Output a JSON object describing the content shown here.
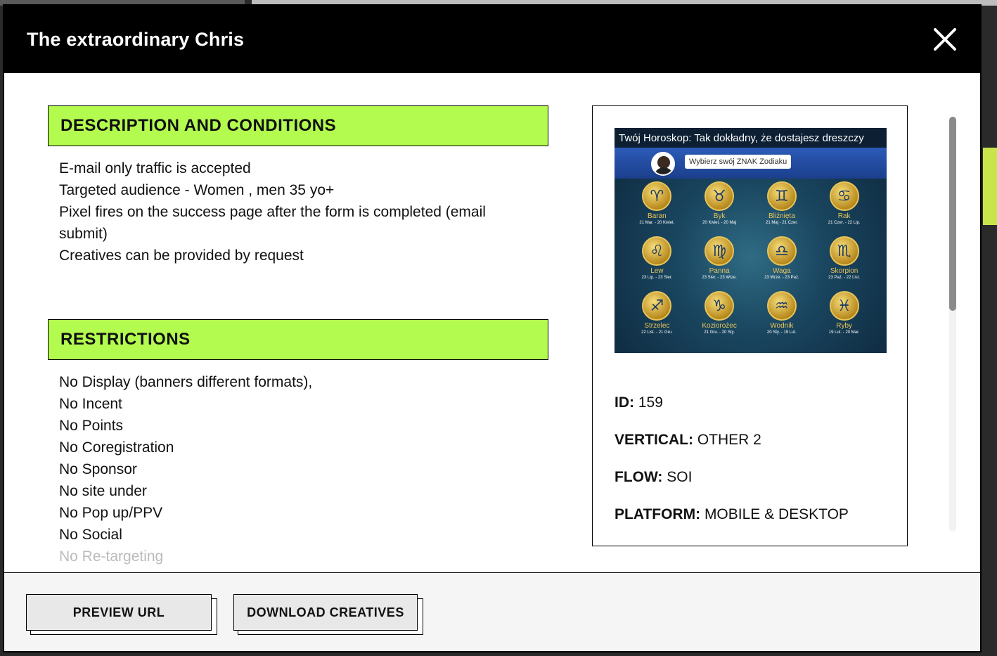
{
  "modal": {
    "title": "The extraordinary Chris"
  },
  "description": {
    "heading": "DESCRIPTION AND CONDITIONS",
    "items": [
      "E-mail only traffic is accepted",
      "Targeted audience - Women , men 35 yo+",
      "Pixel fires on the success page after the form is completed (email submit)",
      "Creatives can be provided by request"
    ]
  },
  "restrictions": {
    "heading": "RESTRICTIONS",
    "items": [
      "No Display (banners different formats),",
      "No Incent",
      "No Points",
      "No Coregistration",
      "No Sponsor",
      "No site under",
      "No Pop up/PPV",
      "No Social",
      "No Re-targeting"
    ]
  },
  "creative": {
    "headline": "Twój Horoskop: Tak dokładny, że dostajesz dreszczy",
    "bubble": "Wybierz swój ZNAK Zodiaku",
    "signs": [
      {
        "symbol": "♈",
        "name": "Baran",
        "dates": "21 Mar. - 20 Kwiet."
      },
      {
        "symbol": "♉",
        "name": "Byk",
        "dates": "20 Kwiet. - 20 Maj"
      },
      {
        "symbol": "♊",
        "name": "Bliźnięta",
        "dates": "21 Maj - 21 Czer."
      },
      {
        "symbol": "♋",
        "name": "Rak",
        "dates": "21 Czer. - 22 Lip."
      },
      {
        "symbol": "♌",
        "name": "Lew",
        "dates": "23 Lip. - 23 Sier."
      },
      {
        "symbol": "♍",
        "name": "Panna",
        "dates": "23 Sier. - 23 Wrze."
      },
      {
        "symbol": "♎",
        "name": "Waga",
        "dates": "23 Wrze. - 23 Paź."
      },
      {
        "symbol": "♏",
        "name": "Skorpion",
        "dates": "23 Paź. - 22 List."
      },
      {
        "symbol": "♐",
        "name": "Strzelec",
        "dates": "22 List. - 21 Gru."
      },
      {
        "symbol": "♑",
        "name": "Koziorożec",
        "dates": "21 Gru. - 20 Sty."
      },
      {
        "symbol": "♒",
        "name": "Wodnik",
        "dates": "20 Sty. - 19 Lut."
      },
      {
        "symbol": "♓",
        "name": "Ryby",
        "dates": "19 Lut. - 20 Mar."
      }
    ]
  },
  "meta": {
    "id_label": "ID:",
    "id_value": "159",
    "vertical_label": "VERTICAL:",
    "vertical_value": "OTHER 2",
    "flow_label": "FLOW:",
    "flow_value": "SOI",
    "platform_label": "PLATFORM:",
    "platform_value": "MOBILE & DESKTOP"
  },
  "footer": {
    "preview_label": "PREVIEW URL",
    "download_label": "DOWNLOAD CREATIVES"
  },
  "colors": {
    "accent": "#b3fb4f",
    "header_bg": "#000000"
  }
}
